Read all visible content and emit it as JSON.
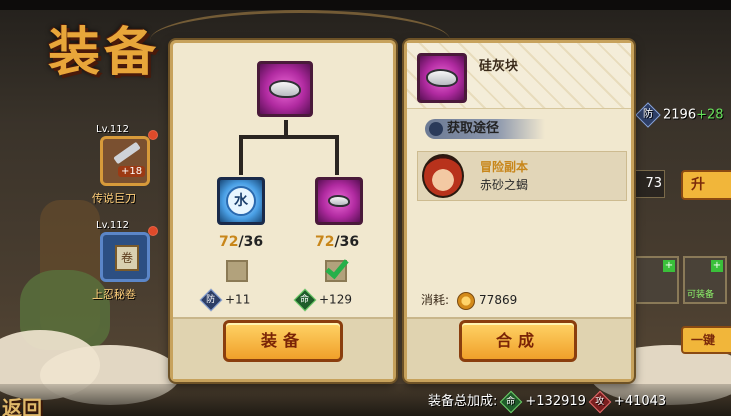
{
  "header": {
    "title": "装备"
  },
  "left_slots": [
    {
      "level": "Lv.112",
      "plus": "+18",
      "name": "传说巨刀"
    },
    {
      "level": "Lv.112",
      "name": "上忍秘卷"
    }
  ],
  "craft_panel": {
    "counts": [
      {
        "have": "72",
        "need": "/36"
      },
      {
        "have": "72",
        "need": "/36"
      }
    ],
    "water_glyph": "水",
    "stats": [
      {
        "icon_label": "防",
        "value": "+11"
      },
      {
        "icon_label": "命",
        "value": "+129"
      }
    ],
    "equip_button": "装备"
  },
  "info_panel": {
    "item_name": "硅灰块",
    "source_label": "获取途径",
    "source": {
      "title": "冒险副本",
      "subtitle": "赤砂之蝎"
    },
    "cost_label": "消耗:",
    "cost_value": "77869",
    "craft_button": "合成"
  },
  "right_peek": {
    "def_label": "防",
    "def_value": "2196",
    "def_bonus": "+28",
    "box_value": "73",
    "upgrade_button": "升",
    "item_label": "可装备",
    "one_key_button": "一键"
  },
  "footer": {
    "total_label": "装备总加成:",
    "life_label": "命",
    "life_value": "+132919",
    "atk_label": "攻",
    "atk_value": "+41043"
  },
  "back_label": "返回"
}
